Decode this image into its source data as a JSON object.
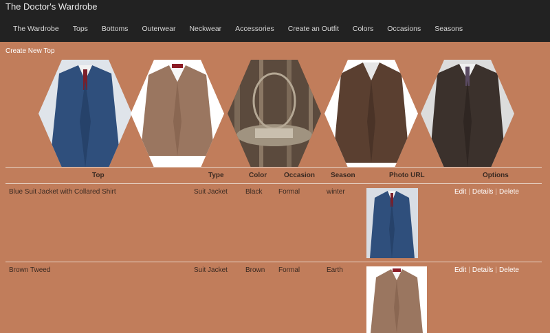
{
  "app": {
    "brand": "The Doctor's Wardrobe",
    "nav": [
      "The Wardrobe",
      "Tops",
      "Bottoms",
      "Outerwear",
      "Neckwear",
      "Accessories",
      "Create an Outfit",
      "Colors",
      "Occasions",
      "Seasons"
    ]
  },
  "page": {
    "create_link": "Create New Top"
  },
  "gallery": [
    {
      "name": "blue-suit-jacket",
      "color": "#2f4f7c"
    },
    {
      "name": "brown-tweed-jacket",
      "color": "#9a7660"
    },
    {
      "name": "tardis-console-room",
      "color": "#5b4a3d"
    },
    {
      "name": "brown-pinstripe-jacket",
      "color": "#5a3f30"
    },
    {
      "name": "dark-pinstripe-jacket",
      "color": "#3b312c"
    }
  ],
  "table": {
    "headers": {
      "top": "Top",
      "type": "Type",
      "color": "Color",
      "occasion": "Occasion",
      "season": "Season",
      "photo": "Photo URL",
      "options": "Options"
    },
    "rows": [
      {
        "top": "Blue Suit Jacket with Collared Shirt",
        "type": "Suit Jacket",
        "color": "Black",
        "occasion": "Formal",
        "season": "winter",
        "edit": "Edit",
        "details": "Details",
        "delete": "Delete",
        "photo_color": "#2f4f7c"
      },
      {
        "top": "Brown Tweed",
        "type": "Suit Jacket",
        "color": "Brown",
        "occasion": "Formal",
        "season": "Earth",
        "edit": "Edit",
        "details": "Details",
        "delete": "Delete",
        "photo_color": "#9a7660"
      }
    ]
  }
}
